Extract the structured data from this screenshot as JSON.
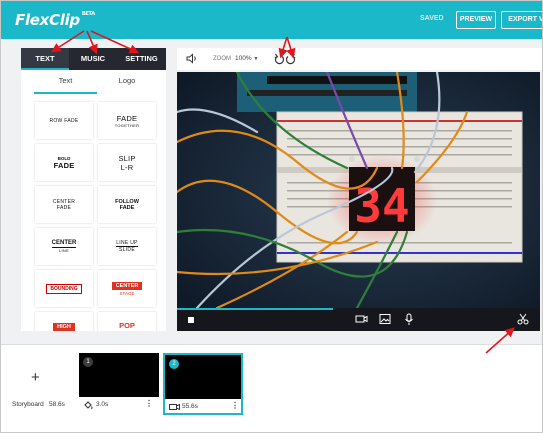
{
  "app": {
    "logo": "FlexClip",
    "logo_badge": "BETA",
    "saved_label": "SAVED",
    "preview_label": "PREVIEW",
    "export_label": "EXPORT V"
  },
  "panel": {
    "tabs": [
      {
        "label": "TEXT",
        "active": true
      },
      {
        "label": "MUSIC",
        "active": false
      },
      {
        "label": "SETTING",
        "active": false
      }
    ],
    "subtabs": [
      {
        "label": "Text",
        "active": true
      },
      {
        "label": "Logo",
        "active": false
      }
    ],
    "tiles": [
      {
        "line1": "ROW FADE"
      },
      {
        "line1": "FADE",
        "line2": "TOGETHER"
      },
      {
        "line1": "BOLD",
        "line2": "FADE"
      },
      {
        "line1": "SLIP",
        "line2": "L-R"
      },
      {
        "line1": "CENTER",
        "line2": "FADE"
      },
      {
        "line1": "FOLLOW",
        "line2": "FADE"
      },
      {
        "line1": "CENTER",
        "line2": "LINE"
      },
      {
        "line1": "LINE UP",
        "line2": "SLIDE"
      },
      {
        "line1": "BOUNDING"
      },
      {
        "line1": "CENTER",
        "line2": "STAGE"
      },
      {
        "line1": "HIGH"
      },
      {
        "line1": "POP"
      }
    ]
  },
  "toolbar": {
    "zoom_label": "ZOOM",
    "zoom_value": "100%"
  },
  "video": {
    "display_digits": "34",
    "progress": 0.43
  },
  "storyboard": {
    "label": "Storyboard",
    "total_duration": "58.6s",
    "scenes": [
      {
        "number": "1",
        "duration": "3.0s",
        "selected": false
      },
      {
        "number": "2",
        "duration": "55.6s",
        "selected": true
      }
    ]
  },
  "colors": {
    "accent": "#1ab8c9",
    "annotation": "#e0161c",
    "panel_dark": "#252830"
  }
}
